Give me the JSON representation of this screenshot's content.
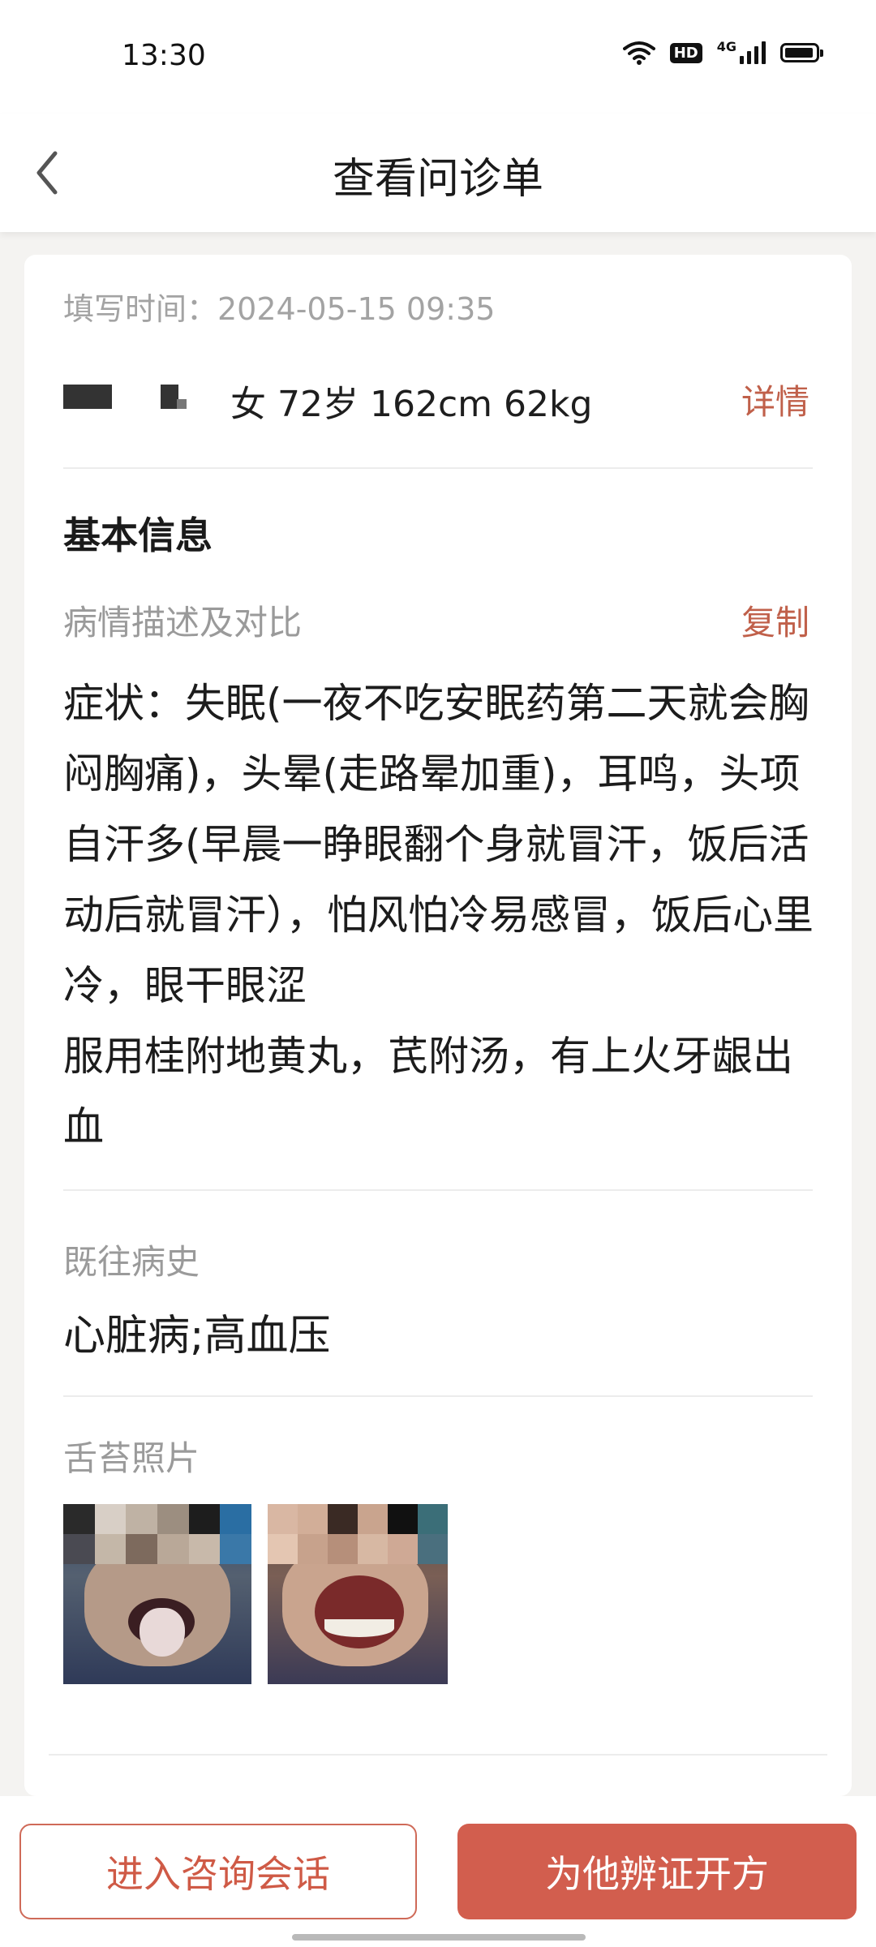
{
  "status_bar": {
    "time": "13:30",
    "hd_label": "HD",
    "network_label": "4G"
  },
  "header": {
    "title": "查看问诊单",
    "back_icon": "back-arrow-icon"
  },
  "form": {
    "fill_time": "填写时间：2024-05-15 09:35",
    "patient": {
      "info": "女 72岁 162cm 62kg",
      "detail_label": "详情"
    },
    "basic_info_title": "基本信息",
    "condition": {
      "label": "病情描述及对比",
      "copy_label": "复制",
      "text": "症状：失眠(一夜不吃安眠药第二天就会胸闷胸痛)，头晕(走路晕加重)，耳鸣，头项自汗多(早晨一睁眼翻个身就冒汗，饭后活动后就冒汗），怕风怕冷易感冒，饭后心里冷，眼干眼涩\n服用桂附地黄丸，芪附汤，有上火牙龈出血"
    },
    "history": {
      "label": "既往病史",
      "text": "心脏病;高血压"
    },
    "tongue_photos": {
      "label": "舌苔照片",
      "count": 2
    }
  },
  "actions": {
    "consult_label": "进入咨询会话",
    "prescribe_label": "为他辨证开方"
  },
  "colors": {
    "accent": "#c0604a",
    "primary_button": "#d25e4e",
    "secondary_text": "#9a9a9a",
    "background": "#f4f3f1"
  }
}
